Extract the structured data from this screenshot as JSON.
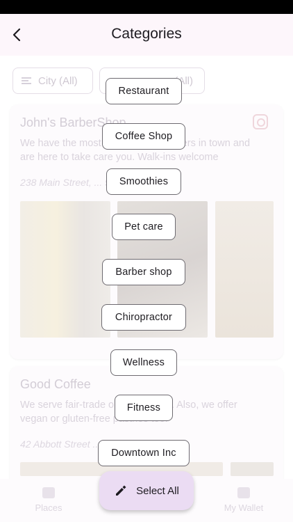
{
  "app_bar": {
    "title": "Categories"
  },
  "filters": [
    {
      "label": "City (All)"
    },
    {
      "label": "(All)"
    }
  ],
  "cards": [
    {
      "title": "John's BarberShop",
      "description": "We have the most experienced barbers in town and are here to take care you. Walk-ins welcome",
      "address": "238 Main Street, ... 9 ON"
    },
    {
      "title": "Good Coffee",
      "description": "We serve fair-trade organic coffee. Also, we offer vegan or gluten-free pastries too!",
      "address": "42 Abbott Street ... ON"
    }
  ],
  "categories": [
    "Restaurant",
    "Coffee Shop",
    "Smoothies",
    "Pet care",
    "Barber shop",
    "Chiropractor",
    "Wellness",
    "Fitness",
    "Downtown Inc"
  ],
  "fab": {
    "label": "Select All",
    "icon": "pencil-icon"
  },
  "bottom_nav": [
    {
      "label": "Places",
      "icon": "store-icon"
    },
    {
      "label": "My Wallet",
      "icon": "wallet-icon"
    }
  ],
  "colors": {
    "app_bar_bg": "#fdf6fb",
    "fab_bg": "#ebdcf3",
    "button_border": "#6d6a70"
  }
}
